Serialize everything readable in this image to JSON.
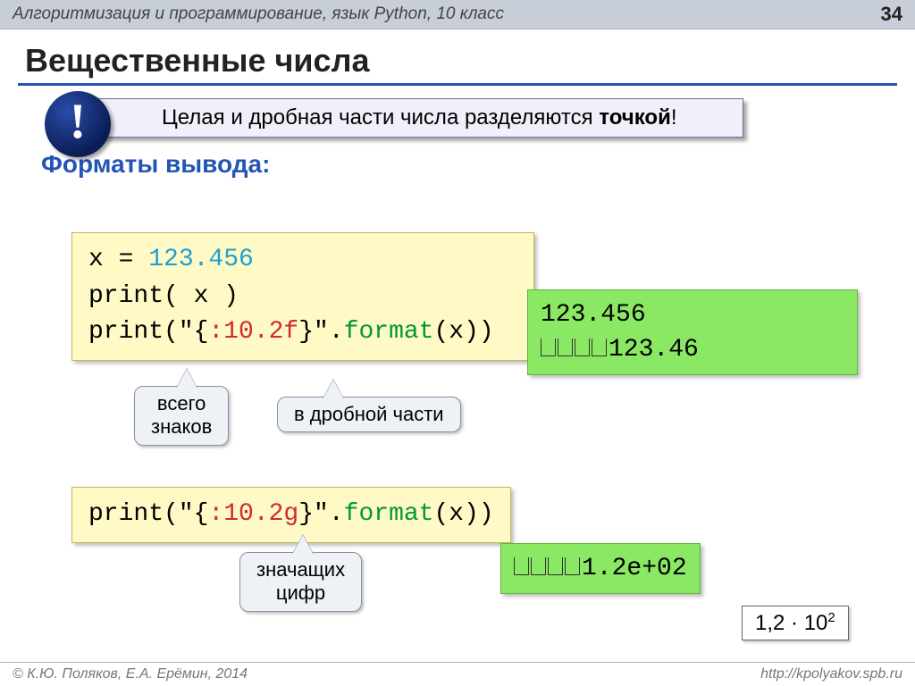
{
  "header": {
    "breadcrumb": "Алгоритмизация и программирование, язык Python, 10 класс",
    "page_number": "34"
  },
  "title": "Вещественные числа",
  "callout": {
    "icon_glyph": "!",
    "text_pre": "Целая и дробная части числа разделяются ",
    "text_bold": "точкой",
    "text_post": "!"
  },
  "subheading": "Форматы вывода:",
  "code": {
    "block1": {
      "line1_a": "x = ",
      "line1_num": "123.456",
      "line2": "print( x )",
      "line3_a": "print(\"{",
      "line3_fmt": ":10.2f",
      "line3_b": "}\".",
      "line3_fn": "format",
      "line3_c": "(x))"
    },
    "block2": {
      "a": "print(\"{",
      "fmt": ":10.2g",
      "b": "}\".",
      "fn": "format",
      "c": "(x))"
    }
  },
  "output": {
    "o1_line1": "123.456",
    "o1_spaces": 4,
    "o1_line2_val": "123.46",
    "o2_spaces": 4,
    "o2_val": "1.2e+02"
  },
  "annotations": {
    "b1": "всего\nзнаков",
    "b2": "в дробной части",
    "b3": "значащих\nцифр"
  },
  "sci_notation": {
    "mantissa": "1,2",
    "sep": " · ",
    "base": "10",
    "exp": "2"
  },
  "footer": {
    "left": "© К.Ю. Поляков, Е.А. Ерёмин, 2014",
    "right": "http://kpolyakov.spb.ru"
  }
}
